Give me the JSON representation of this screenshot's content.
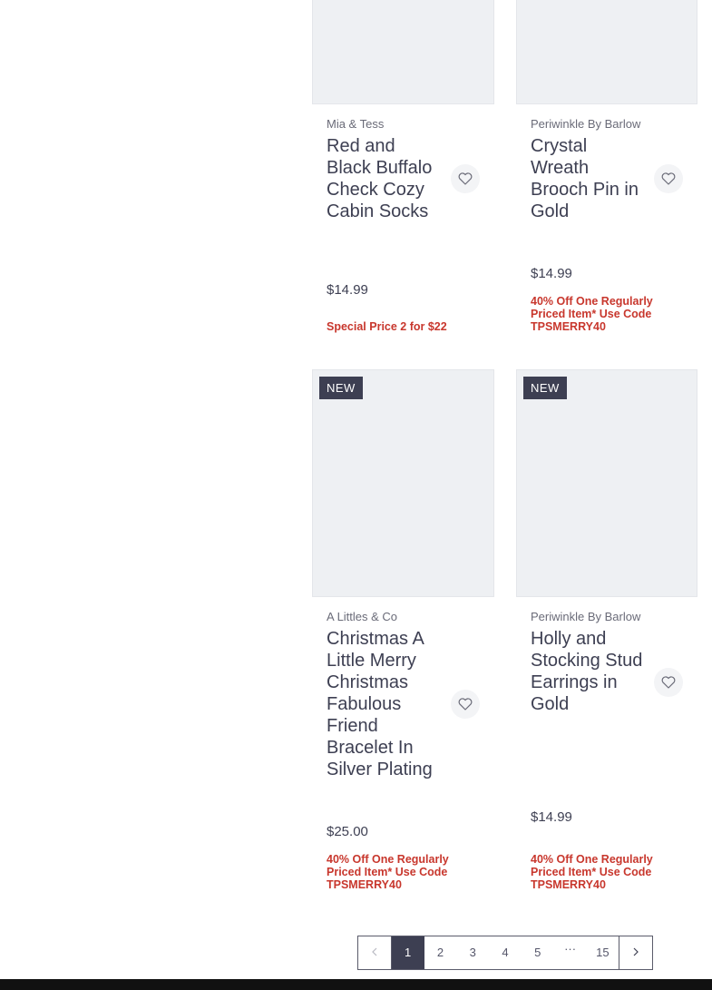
{
  "products": [
    {
      "brand": "Mia & Tess",
      "title": "Red and Black Buffalo Check Cozy Cabin Socks",
      "price": "$14.99",
      "promo": "Special Price 2 for $22",
      "badge": ""
    },
    {
      "brand": "Periwinkle By Barlow",
      "title": "Crystal Wreath Brooch Pin in Gold",
      "price": "$14.99",
      "promo": "40% Off One Regularly Priced Item* Use Code TPSMERRY40",
      "badge": ""
    },
    {
      "brand": "A Littles & Co",
      "title": "Christmas A Little Merry Christmas Fabulous Friend Bracelet In Silver Plating",
      "price": "$25.00",
      "promo": "40% Off One Regularly Priced Item* Use Code TPSMERRY40",
      "badge": "NEW"
    },
    {
      "brand": "Periwinkle By Barlow",
      "title": "Holly and Stocking Stud Earrings in Gold",
      "price": "$14.99",
      "promo": "40% Off One Regularly Priced Item* Use Code TPSMERRY40",
      "badge": "NEW"
    }
  ],
  "pagination": {
    "prev_icon": "chevron-left-icon",
    "next_icon": "chevron-right-icon",
    "pages": [
      "1",
      "2",
      "3",
      "4",
      "5",
      "···",
      "15"
    ],
    "current": "1"
  },
  "icons": {
    "wishlist": "heart-outline-icon"
  },
  "colors": {
    "promo": "#c8372d",
    "badge_bg": "#3d3f52",
    "image_placeholder": "#eef0f3"
  }
}
